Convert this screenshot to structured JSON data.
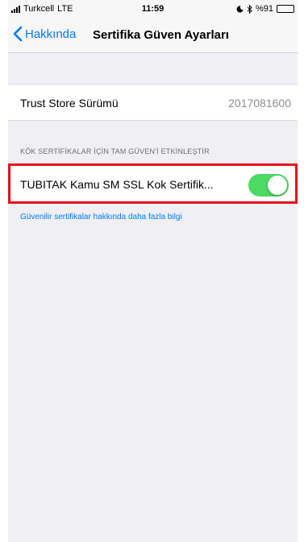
{
  "status_bar": {
    "carrier": "Turkcell",
    "network": "LTE",
    "time": "11:59",
    "battery": "%91",
    "battery_level": 0.91
  },
  "nav": {
    "back_label": "Hakkında",
    "title": "Sertifika Güven Ayarları"
  },
  "trust_store": {
    "label": "Trust Store Sürümü",
    "value": "2017081600"
  },
  "root_certs": {
    "section_header": "KÖK SERTİFİKALAR İÇİN TAM GÜVEN'İ ETKİNLEŞTİR",
    "items": [
      {
        "label": "TUBITAK Kamu SM SSL Kok Sertifik...",
        "enabled": true
      }
    ],
    "info_link": "Güvenilir sertifikalar hakkında daha fazla bilgi"
  },
  "colors": {
    "accent": "#007aff",
    "toggle_on": "#4cd964",
    "highlight": "#e8121b",
    "background": "#efeff4"
  }
}
